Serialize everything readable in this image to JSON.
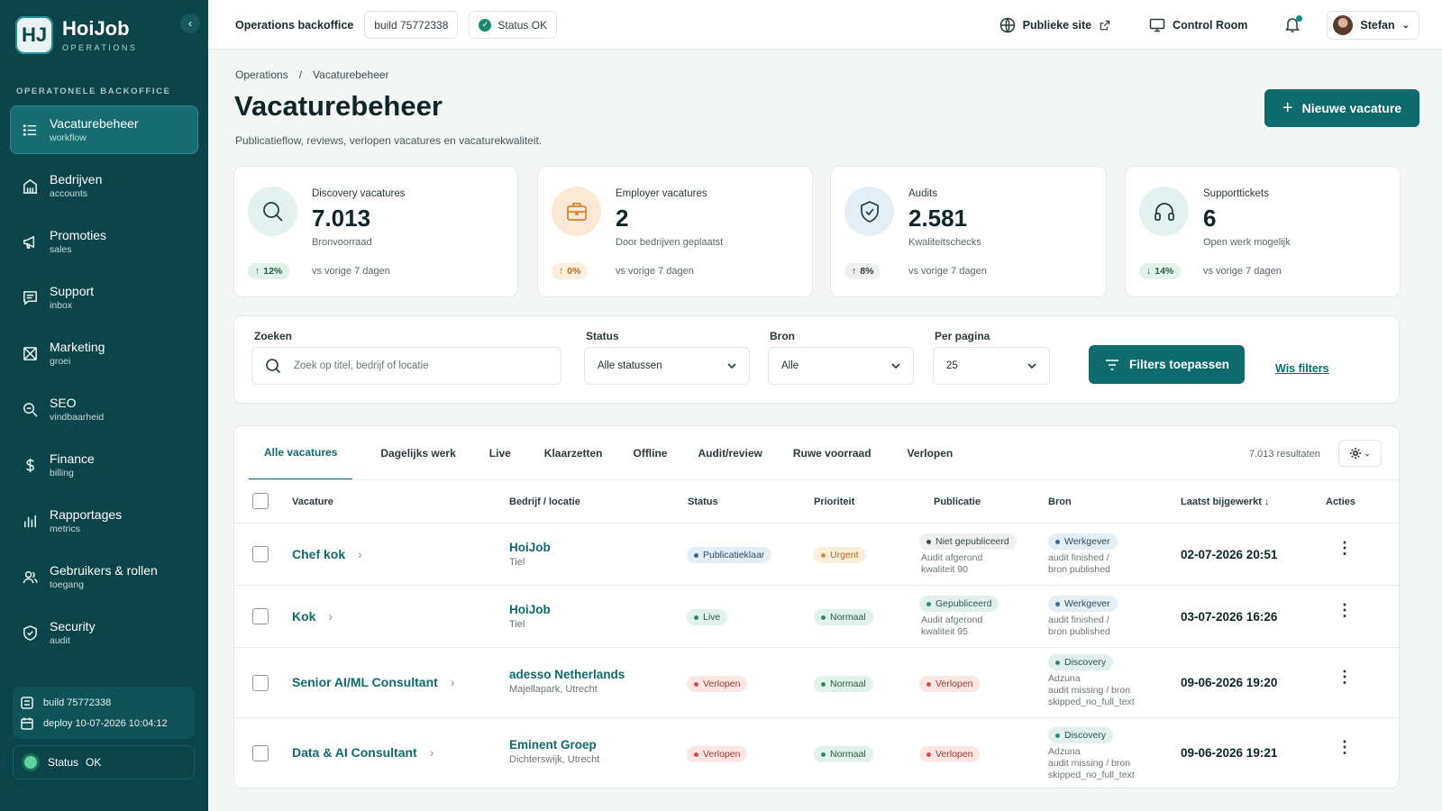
{
  "brand": {
    "name": "HoiJob",
    "sub": "OPERATIONS",
    "logo": "HJ"
  },
  "sidebar": {
    "section_label": "OPERATONELE BACKOFFICE",
    "items": [
      {
        "label": "Vacaturebeheer",
        "sub": "workflow",
        "icon": "list-icon"
      },
      {
        "label": "Bedrijven",
        "sub": "accounts",
        "icon": "building-icon"
      },
      {
        "label": "Promoties",
        "sub": "sales",
        "icon": "megaphone-icon"
      },
      {
        "label": "Support",
        "sub": "inbox",
        "icon": "chat-icon"
      },
      {
        "label": "Marketing",
        "sub": "groei",
        "icon": "mail-icon"
      },
      {
        "label": "SEO",
        "sub": "vindbaarheid",
        "icon": "search-icon"
      },
      {
        "label": "Finance",
        "sub": "billing",
        "icon": "dollar-icon"
      },
      {
        "label": "Rapportages",
        "sub": "metrics",
        "icon": "bars-icon"
      },
      {
        "label": "Gebruikers & rollen",
        "sub": "toegang",
        "icon": "users-icon"
      },
      {
        "label": "Security",
        "sub": "audit",
        "icon": "shield-icon"
      }
    ],
    "build": "build  75772338",
    "deploy": "deploy 10-07-2026 10:04:12",
    "status_label": "Status",
    "status_value": "OK"
  },
  "topbar": {
    "title": "Operations backoffice",
    "build": "build 75772338",
    "status": "Status OK",
    "public_site": "Publieke site",
    "control_room": "Control Room",
    "user": "Stefan"
  },
  "page": {
    "breadcrumb_root": "Operations",
    "breadcrumb_sep": "/",
    "breadcrumb_current": "Vacaturebeheer",
    "title": "Vacaturebeheer",
    "subtitle": "Publicatieflow, reviews, verlopen vacatures en vacaturekwaliteit.",
    "new_button": "Nieuwe vacature"
  },
  "kpis": [
    {
      "label": "Discovery vacatures",
      "value": "7.013",
      "desc": "Bronvoorraad",
      "delta": "12%",
      "dir": "↑",
      "vs": "vs vorige 7 dagen",
      "icon": "search-icon"
    },
    {
      "label": "Employer vacatures",
      "value": "2",
      "desc": "Door bedrijven geplaatst",
      "delta": "0%",
      "dir": "↑",
      "vs": "vs vorige 7 dagen",
      "icon": "briefcase-icon"
    },
    {
      "label": "Audits",
      "value": "2.581",
      "desc": "Kwaliteitschecks",
      "delta": "8%",
      "dir": "↑",
      "vs": "vs vorige 7 dagen",
      "icon": "shield-check-icon"
    },
    {
      "label": "Supporttickets",
      "value": "6",
      "desc": "Open werk mogelijk",
      "delta": "14%",
      "dir": "↓",
      "vs": "vs vorige 7 dagen",
      "icon": "headset-icon"
    }
  ],
  "filters": {
    "search_label": "Zoeken",
    "search_placeholder": "Zoek op titel, bedrijf of locatie",
    "status_label": "Status",
    "status_value": "Alle statussen",
    "source_label": "Bron",
    "source_value": "Alle",
    "per_page_label": "Per pagina",
    "per_page_value": "25",
    "apply": "Filters toepassen",
    "clear": "Wis filters"
  },
  "tabs": [
    "Alle vacatures",
    "Dagelijks werk",
    "Live",
    "Klaarzetten",
    "Offline",
    "Audit/review",
    "Ruwe voorraad",
    "Verlopen"
  ],
  "results": "7.013 resultaten",
  "table": {
    "headers": {
      "vacancy": "Vacature",
      "company": "Bedrijf / locatie",
      "status": "Status",
      "priority": "Prioriteit",
      "publication": "Publicatie",
      "source": "Bron",
      "updated": "Laatst bijgewerkt ↓",
      "actions": "Acties"
    },
    "rows": [
      {
        "title": "Chef kok",
        "company": "HoiJob",
        "location": "Tiel",
        "status": "Publicatieklaar",
        "priority": "Urgent",
        "publication": "Niet gepubliceerd",
        "pub_note1": "Audit afgerond",
        "pub_note2": "kwaliteit 90",
        "source": "Werkgever",
        "src_note1": "audit finished /",
        "src_note2": "bron published",
        "src_note3": "",
        "updated": "02-07-2026 20:51"
      },
      {
        "title": "Kok",
        "company": "HoiJob",
        "location": "Tiel",
        "status": "Live",
        "priority": "Normaal",
        "publication": "Gepubliceerd",
        "pub_note1": "Audit afgerond",
        "pub_note2": "kwaliteit 95",
        "source": "Werkgever",
        "src_note1": "audit finished /",
        "src_note2": "bron published",
        "src_note3": "",
        "updated": "03-07-2026 16:26"
      },
      {
        "title": "Senior AI/ML Consultant",
        "company": "adesso Netherlands",
        "location": "Majellapark, Utrecht",
        "status": "Verlopen",
        "priority": "Normaal",
        "publication": "Verlopen",
        "pub_note1": "",
        "pub_note2": "",
        "source": "Discovery",
        "src_note1": "Adzuna",
        "src_note2": "audit missing / bron",
        "src_note3": "skipped_no_full_text",
        "updated": "09-06-2026 19:20"
      },
      {
        "title": "Data & AI Consultant",
        "company": "Eminent Groep",
        "location": "Dichterswijk, Utrecht",
        "status": "Verlopen",
        "priority": "Normaal",
        "publication": "Verlopen",
        "pub_note1": "",
        "pub_note2": "",
        "source": "Discovery",
        "src_note1": "Adzuna",
        "src_note2": "audit missing / bron",
        "src_note3": "skipped_no_full_text",
        "updated": "09-06-2026 19:21"
      }
    ]
  },
  "colors": {
    "sidebar": "#0b4549",
    "accent": "#0f6a6c"
  }
}
